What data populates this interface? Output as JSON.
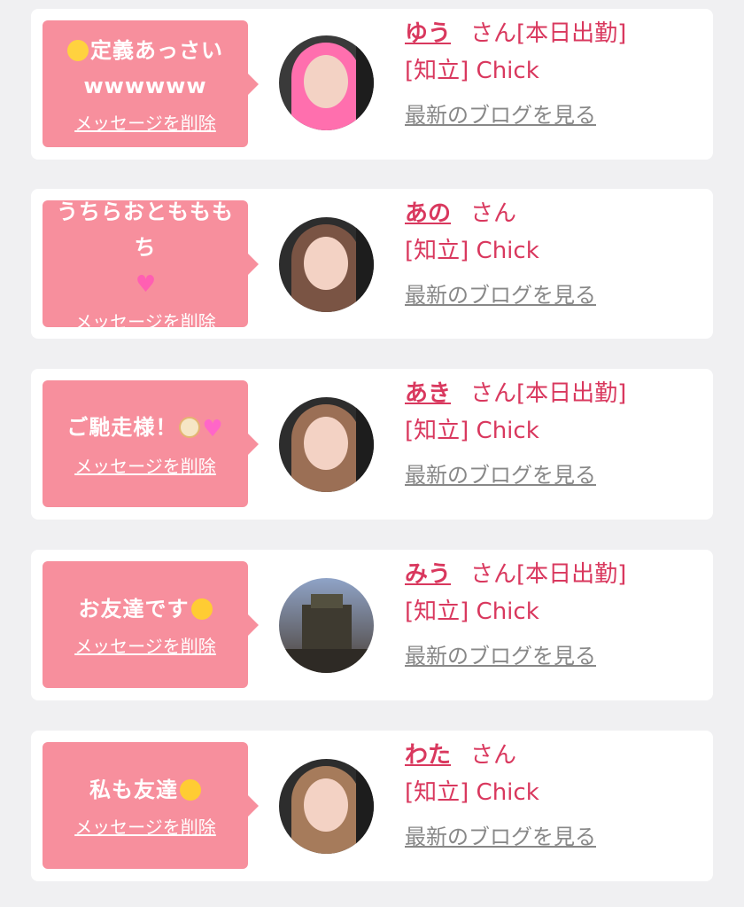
{
  "cards": [
    {
      "message": "定義あっさい wwwwww",
      "emoji": "chick",
      "delete_label": "メッセージを削除",
      "name": "ゆう",
      "honorific": "さん",
      "status": "[本日出勤]",
      "shop": "[知立] Chick",
      "blog_label": "最新のブログを見る"
    },
    {
      "message": "うちらおともももち",
      "emoji": "heart",
      "delete_label": "メッセージを削除",
      "name": "あの",
      "honorific": "さん",
      "status": "",
      "shop": "[知立] Chick",
      "blog_label": "最新のブログを見る"
    },
    {
      "message": "ご馳走様！",
      "emoji": "bowl-sparkle",
      "delete_label": "メッセージを削除",
      "name": "あき",
      "honorific": "さん",
      "status": "[本日出勤]",
      "shop": "[知立] Chick",
      "blog_label": "最新のブログを見る"
    },
    {
      "message": "お友達です",
      "emoji": "smile",
      "delete_label": "メッセージを削除",
      "name": "みう",
      "honorific": "さん",
      "status": "[本日出勤]",
      "shop": "[知立] Chick",
      "blog_label": "最新のブログを見る"
    },
    {
      "message": "私も友達",
      "emoji": "raised-eyebrow",
      "delete_label": "メッセージを削除",
      "name": "わた",
      "honorific": "さん",
      "status": "",
      "shop": "[知立] Chick",
      "blog_label": "最新のブログを見る"
    }
  ],
  "colors": {
    "bubble": "#f78f9d",
    "accent": "#d9385e",
    "link_gray": "#888888",
    "background": "#f0f0f2"
  }
}
